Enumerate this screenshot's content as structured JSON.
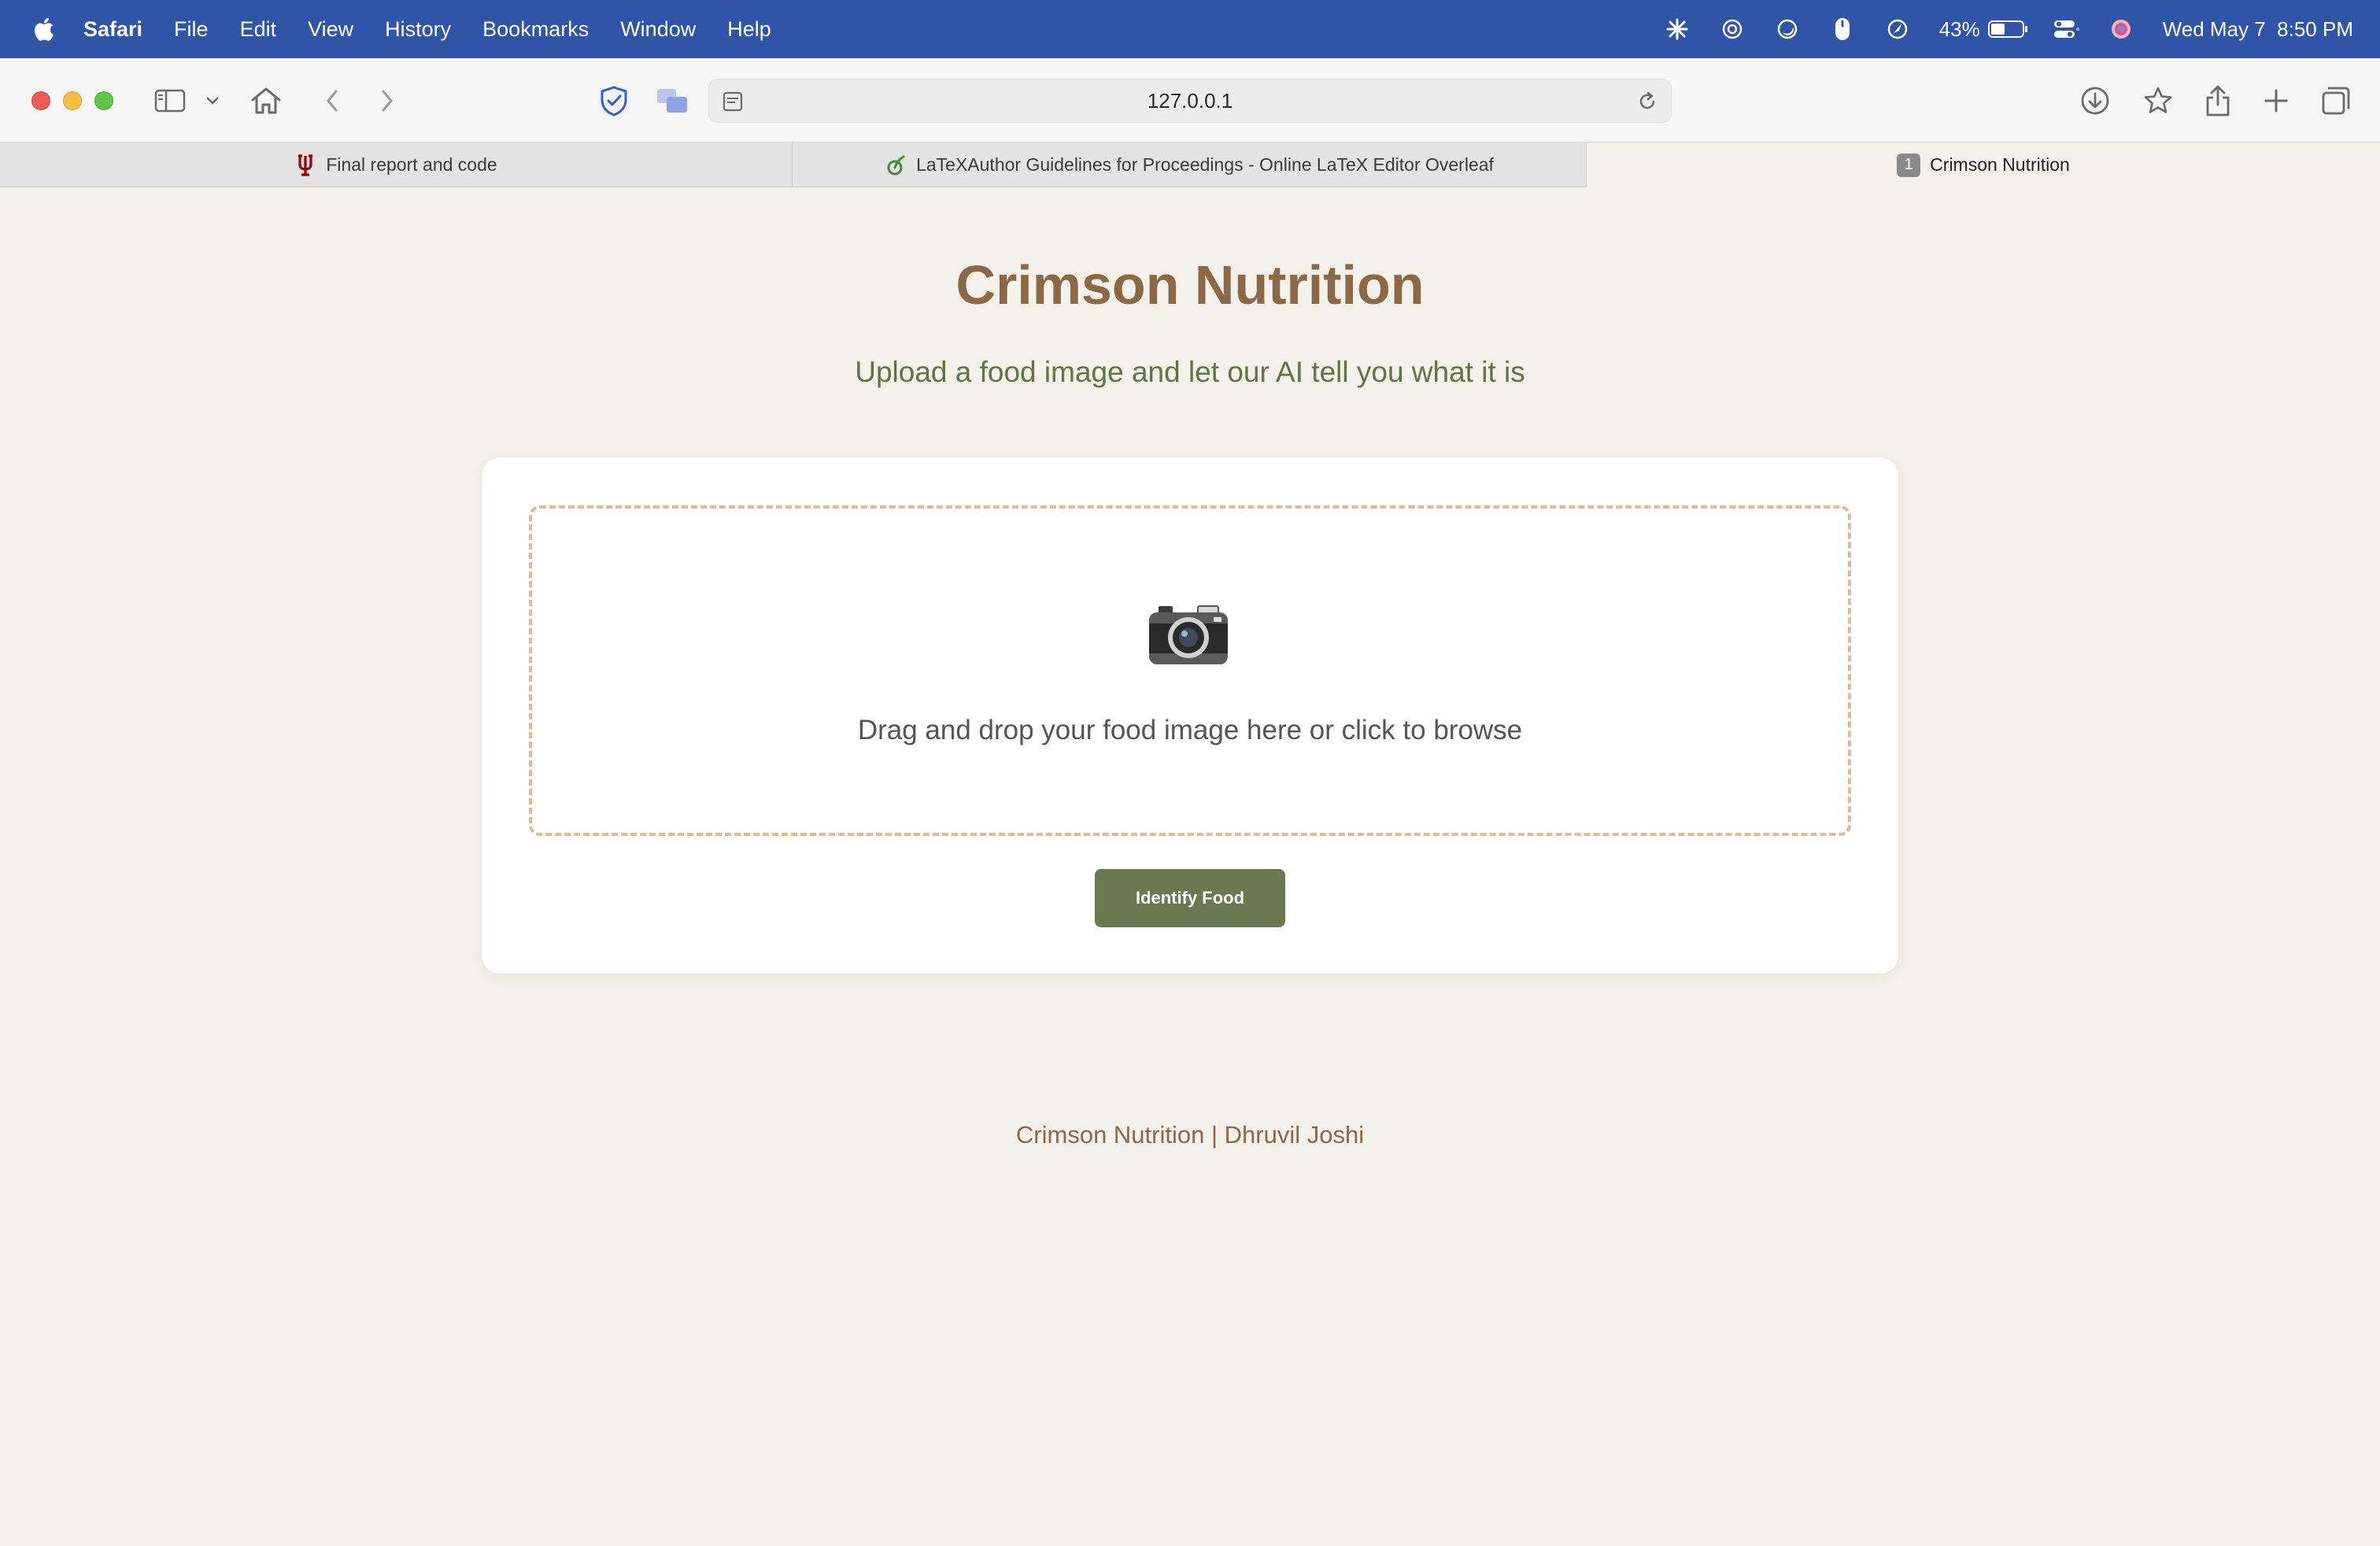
{
  "menubar": {
    "app_name": "Safari",
    "items": [
      "File",
      "Edit",
      "View",
      "History",
      "Bookmarks",
      "Window",
      "Help"
    ],
    "battery_percent": "43%",
    "battery_level": 0.43,
    "datetime": "Wed May 7  8:50 PM",
    "status_icons": [
      "perplexity-icon",
      "chatgpt-icon",
      "focus-icon",
      "mouse-icon",
      "spotlight-icon",
      "battery-icon",
      "control-center-icon",
      "siri-icon"
    ]
  },
  "toolbar": {
    "url": "127.0.0.1",
    "icons": [
      "sidebar-icon",
      "chevron-down-icon",
      "home-icon",
      "back-icon",
      "forward-icon",
      "privacy-shield-icon",
      "translate-icon",
      "reader-icon",
      "reload-icon",
      "download-icon",
      "bookmark-star-icon",
      "share-icon",
      "new-tab-icon",
      "tab-overview-icon"
    ]
  },
  "tabs": [
    {
      "label": "Final report and code",
      "icon": "iu-trident-icon",
      "active": false
    },
    {
      "label": "LaTeXAuthor Guidelines for Proceedings - Online LaTeX Editor Overleaf",
      "icon": "overleaf-icon",
      "active": false
    },
    {
      "label": "Crimson Nutrition",
      "icon": "numbered-tab-icon",
      "badge": "1",
      "active": true
    }
  ],
  "page": {
    "title": "Crimson Nutrition",
    "subtitle": "Upload a food image and let our AI tell you what it is",
    "dropzone_text": "Drag and drop your food image here or click to browse",
    "dropzone_icon": "camera-icon",
    "button_label": "Identify Food",
    "footer": "Crimson Nutrition | Dhruvil Joshi"
  },
  "colors": {
    "menubar": "#2f54a8",
    "page_background": "#f4f1ea",
    "title": "#8b6846",
    "subtitle": "#5f7447",
    "dropzone_border": "#e0bb93",
    "button": "#6a7a50"
  }
}
